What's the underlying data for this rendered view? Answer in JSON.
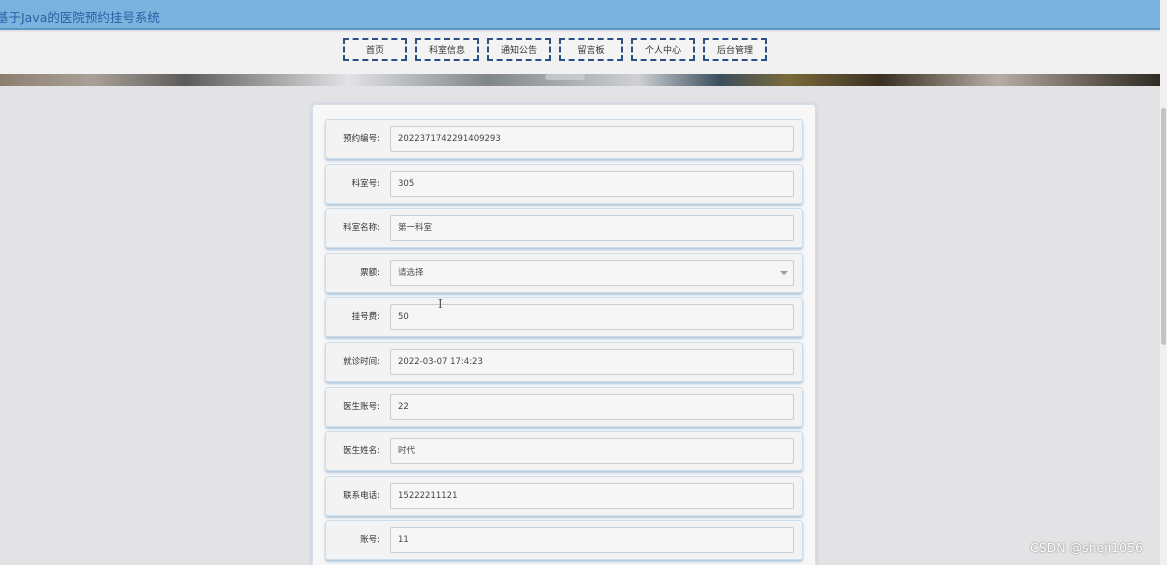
{
  "header": {
    "title": "基于Java的医院预约挂号系统"
  },
  "nav": [
    {
      "label": "首页",
      "name": "nav-home"
    },
    {
      "label": "科室信息",
      "name": "nav-department-info"
    },
    {
      "label": "通知公告",
      "name": "nav-announcements"
    },
    {
      "label": "留言板",
      "name": "nav-message-board"
    },
    {
      "label": "个人中心",
      "name": "nav-personal-center"
    },
    {
      "label": "后台管理",
      "name": "nav-admin"
    }
  ],
  "form": {
    "fields": [
      {
        "label": "预约编号:",
        "value": "2022371742291409293",
        "kind": "input"
      },
      {
        "label": "科室号:",
        "value": "305",
        "kind": "input"
      },
      {
        "label": "科室名称:",
        "value": "第一科室",
        "kind": "input"
      },
      {
        "label": "票额:",
        "value": "请选择",
        "kind": "select"
      },
      {
        "label": "挂号费:",
        "value": "50",
        "kind": "input"
      },
      {
        "label": "就诊时间:",
        "value": "2022-03-07 17:4:23",
        "kind": "input"
      },
      {
        "label": "医生账号:",
        "value": "22",
        "kind": "input"
      },
      {
        "label": "医生姓名:",
        "value": "时代",
        "kind": "input"
      },
      {
        "label": "联系电话:",
        "value": "15222211121",
        "kind": "input"
      },
      {
        "label": "账号:",
        "value": "11",
        "kind": "input"
      }
    ]
  },
  "watermark": "CSDN @sheji1056",
  "colors": {
    "header_bg": "#7ab3de",
    "header_text": "#2b5fa3",
    "nav_border": "#2c4f86",
    "card_border": "#cfdde9"
  }
}
